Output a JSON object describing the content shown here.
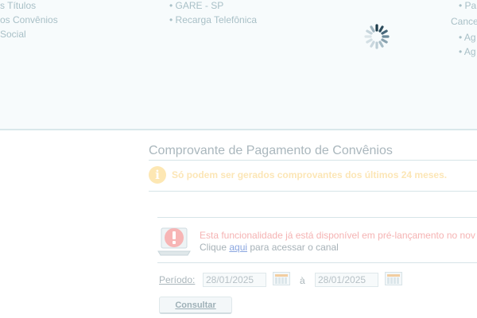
{
  "top_menu": {
    "col1": [
      "s Títulos",
      "os Convênios",
      " Social"
    ],
    "col2": [
      "• GARE - SP",
      "• Recarga Telefônica"
    ],
    "col3": [
      "• Pa",
      "Cance",
      "• Ag",
      "• Ag"
    ]
  },
  "page_title": "Comprovante de Pagamento de Convênios",
  "info_message": "Só podem ser gerados comprovantes dos últimos 24 meses.",
  "alert": {
    "line1": "Esta funcionalidade já está disponível em pré-lançamento no nov",
    "line2_prefix": "Clique ",
    "link_text": "aqui",
    "line2_suffix": " para acessar o canal"
  },
  "form": {
    "period_label": "Período:",
    "start_date": "28/01/2025",
    "separator": "à",
    "end_date": "28/01/2025",
    "submit_label": "Consultar"
  },
  "colors": {
    "accent_link": "#8aa6e0",
    "info": "#fde7b3",
    "alert": "#f5b3b3"
  }
}
